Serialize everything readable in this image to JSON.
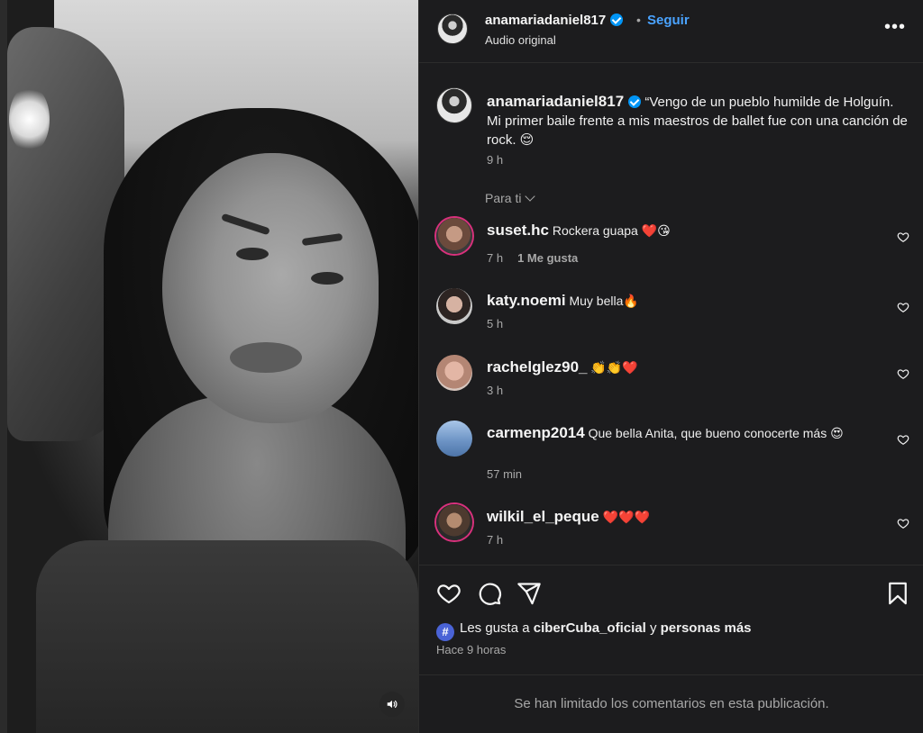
{
  "header": {
    "username": "anamariadaniel817",
    "separator": "•",
    "follow_label": "Seguir",
    "audio_label": "Audio original",
    "more_label": "•••"
  },
  "caption": {
    "username": "anamariadaniel817",
    "text": "“Vengo de un pueblo humilde de Holguín. Mi primer baile frente a mis maestros de ballet fue con una canción de rock. 😌",
    "time": "9 h"
  },
  "filter": {
    "label": "Para ti"
  },
  "comments": [
    {
      "username": "suset.hc",
      "text": "Rockera guapa ❤️😘",
      "time": "7 h",
      "likes": "1 Me gusta"
    },
    {
      "username": "katy.noemi",
      "text": "Muy bella🔥",
      "time": "5 h"
    },
    {
      "username": "rachelglez90_",
      "text": "👏👏❤️",
      "time": "3 h"
    },
    {
      "username": "carmenp2014",
      "text": "Que bella Anita, que bueno conocerte más 😍",
      "time": "57 min"
    },
    {
      "username": "wilkil_el_peque",
      "text": "❤️❤️❤️",
      "time": "7 h"
    }
  ],
  "likes": {
    "avatar_glyph": "#",
    "prefix": "Les gusta a",
    "user": "ciberCuba_oficial",
    "connector": "y",
    "others": "personas más",
    "posted": "Hace 9 horas"
  },
  "footer": {
    "limited": "Se han limitado los comentarios en esta publicación."
  },
  "icons": [
    "heart-icon",
    "comment-icon",
    "share-icon",
    "bookmark-icon",
    "speaker-icon",
    "verified-icon",
    "chevron-down-icon"
  ],
  "colors": {
    "follow": "#4aa3ff",
    "verified": "#0095f6",
    "panel": "#1c1c1e"
  }
}
